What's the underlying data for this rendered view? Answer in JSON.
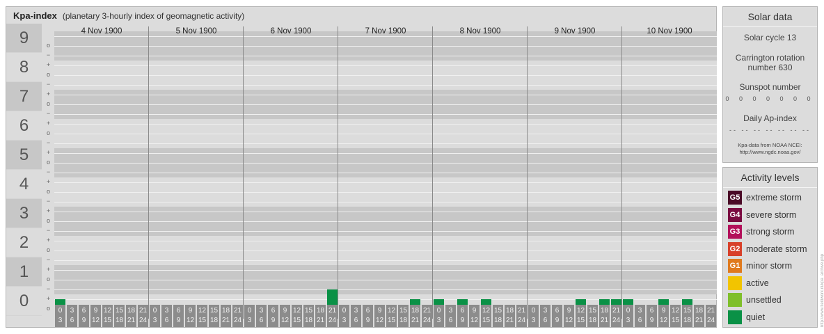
{
  "header": {
    "title": "Kpa-index",
    "subtitle": "(planetary 3-hourly index of geomagnetic activity)"
  },
  "chart_data": {
    "type": "bar",
    "ylim": [
      0,
      9
    ],
    "y_levels": [
      "0",
      "1",
      "2",
      "3",
      "4",
      "5",
      "6",
      "7",
      "8",
      "9"
    ],
    "sub_levels": [
      "−",
      "o",
      "+"
    ],
    "days": [
      "4 Nov 1900",
      "5 Nov 1900",
      "6 Nov 1900",
      "7 Nov 1900",
      "8 Nov 1900",
      "9 Nov 1900",
      "10 Nov 1900"
    ],
    "interval_start": [
      "0",
      "3",
      "6",
      "9",
      "12",
      "15",
      "18",
      "21"
    ],
    "interval_end": [
      "3",
      "6",
      "9",
      "12",
      "15",
      "18",
      "21",
      "24"
    ],
    "series": [
      {
        "values": [
          [
            0.33,
            0,
            0,
            0,
            0,
            0,
            0,
            0
          ],
          [
            0,
            0,
            0,
            0,
            0,
            0,
            0,
            0
          ],
          [
            0,
            0,
            0,
            0,
            0,
            0,
            0,
            0.67
          ],
          [
            0,
            0,
            0,
            0,
            0,
            0,
            0.33,
            0
          ],
          [
            0.33,
            0,
            0.33,
            0,
            0.33,
            0,
            0,
            0
          ],
          [
            0,
            0,
            0,
            0,
            0.33,
            0,
            0.33,
            0.33
          ],
          [
            0.33,
            0,
            0,
            0.33,
            0,
            0.33,
            0,
            0
          ]
        ]
      }
    ],
    "bar_color": "#0a9146",
    "grid": true
  },
  "solar": {
    "title": "Solar data",
    "cycle": "Solar cycle 13",
    "carrington_1": "Carrington rotation",
    "carrington_2": "number 630",
    "sunspot_label": "Sunspot number",
    "sunspot_values": [
      "0",
      "0",
      "0",
      "0",
      "0",
      "0",
      "0"
    ],
    "ap_label": "Daily Ap-index",
    "ap_values": [
      "--",
      "--",
      "--",
      "--",
      "--",
      "--",
      "--"
    ],
    "source_1": "Kpa-data from NOAA NCEI:",
    "source_2": "http://www.ngdc.noaa.gov/"
  },
  "activity": {
    "title": "Activity levels",
    "items": [
      {
        "code": "G5",
        "label": "extreme storm",
        "color": "#4a0a26"
      },
      {
        "code": "G4",
        "label": "severe storm",
        "color": "#7a0a40"
      },
      {
        "code": "G3",
        "label": "strong storm",
        "color": "#b3105a"
      },
      {
        "code": "G2",
        "label": "moderate storm",
        "color": "#d8402a"
      },
      {
        "code": "G1",
        "label": "minor storm",
        "color": "#e07a1e"
      },
      {
        "code": "",
        "label": "active",
        "color": "#f2c400"
      },
      {
        "code": "",
        "label": "unsettled",
        "color": "#7fbf2a"
      },
      {
        "code": "",
        "label": "quiet",
        "color": "#0a9146"
      }
    ]
  },
  "side_text": "http://www.fieldwork.nl/kpa_archive.php"
}
